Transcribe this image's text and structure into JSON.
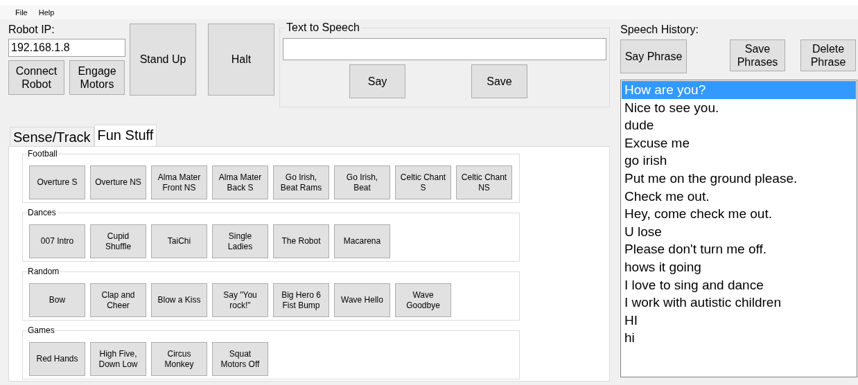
{
  "menu": [
    {
      "label": "File"
    },
    {
      "label": "Help"
    }
  ],
  "connection": {
    "label": "Robot IP:",
    "value": "192.168.1.8",
    "buttons": [
      "Connect Robot",
      "Engage Motors"
    ]
  },
  "actions": [
    "Stand Up",
    "Halt"
  ],
  "text_to_speech": {
    "title": "Text to Speech",
    "buttons": [
      "Say",
      "Save"
    ]
  },
  "tabs": [
    {
      "label": "Sense/Track",
      "selected": false
    },
    {
      "label": "Fun Stuff",
      "selected": true
    }
  ],
  "groups": [
    {
      "title": "Football",
      "buttons": [
        "Overture S",
        "Overture NS",
        "Alma Mater Front NS",
        "Alma Mater Back S",
        "Go Irish, Beat Rams",
        "Go Irish, Beat",
        "Celtic Chant S",
        "Celtic Chant NS"
      ]
    },
    {
      "title": "Dances",
      "buttons": [
        "007 Intro",
        "Cupid Shuffle",
        "TaiChi",
        "Single Ladies",
        "The Robot",
        "Macarena"
      ]
    },
    {
      "title": "Random",
      "buttons": [
        "Bow",
        "Clap and Cheer",
        "Blow a Kiss",
        "Say \"You rock!\"",
        "Big Hero 6 Fist Bump",
        "Wave Hello",
        "Wave Goodbye"
      ]
    },
    {
      "title": "Games",
      "buttons": [
        "Red Hands",
        "High Five, Down Low",
        "Circus Monkey",
        "Squat Motors Off"
      ]
    }
  ],
  "speech_history": {
    "label": "Speech History:",
    "buttons": [
      "Say Phrase",
      "Save Phrases",
      "Delete Phrase"
    ],
    "items": [
      {
        "text": "How are you?",
        "selected": true
      },
      {
        "text": "Nice to see you.",
        "selected": false
      },
      {
        "text": "dude",
        "selected": false
      },
      {
        "text": "Excuse me",
        "selected": false
      },
      {
        "text": "go irish",
        "selected": false
      },
      {
        "text": "Put me on the ground please.",
        "selected": false
      },
      {
        "text": "Check me out.",
        "selected": false
      },
      {
        "text": "Hey, come check me out.",
        "selected": false
      },
      {
        "text": "U lose",
        "selected": false
      },
      {
        "text": "Please don't turn me off.",
        "selected": false
      },
      {
        "text": "hows it going",
        "selected": false
      },
      {
        "text": "I love to sing and dance",
        "selected": false
      },
      {
        "text": "I work with autistic children",
        "selected": false
      },
      {
        "text": "HI",
        "selected": false
      },
      {
        "text": "hi",
        "selected": false
      }
    ]
  }
}
